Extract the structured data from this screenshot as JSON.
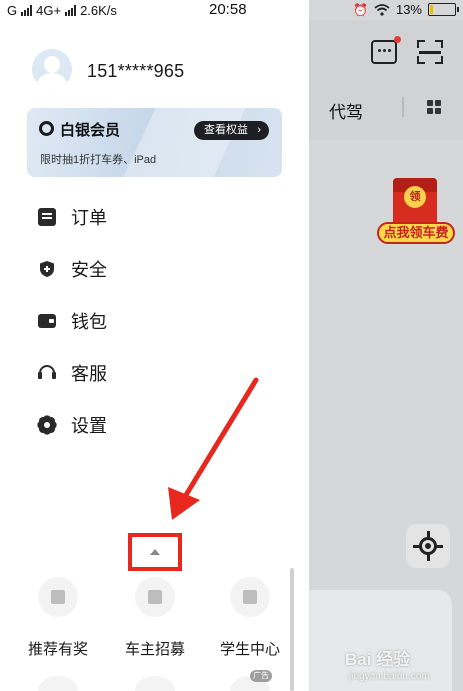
{
  "status_bar": {
    "carrier_left": "G",
    "network": "4G+",
    "speed": "2.6K/s",
    "time": "20:58",
    "battery": "13%",
    "battery_level": 0.13
  },
  "drawer": {
    "phone": "151*****965",
    "member_card": {
      "title": "白银会员",
      "button": "查看权益",
      "subtitle": "限时抽1折打车券、iPad"
    },
    "menu": [
      {
        "label": "订单",
        "icon": "order-icon"
      },
      {
        "label": "安全",
        "icon": "shield-icon"
      },
      {
        "label": "钱包",
        "icon": "wallet-icon"
      },
      {
        "label": "客服",
        "icon": "headset-icon"
      },
      {
        "label": "设置",
        "icon": "gear-icon"
      }
    ],
    "quick": [
      {
        "label": "推荐有奖",
        "icon": "gift-icon"
      },
      {
        "label": "车主招募",
        "icon": "driver-icon"
      },
      {
        "label": "学生中心",
        "icon": "graduation-cap-icon"
      }
    ],
    "ad_tag": "广告"
  },
  "background": {
    "tab": "代驾",
    "redpacket_coin": "领",
    "redpacket_label": "点我领车费"
  },
  "watermark": {
    "text": "Bai 经验",
    "url": "jingyan.baidu.com"
  },
  "colors": {
    "highlight": "#e8281e",
    "arrow": "#e8281e"
  }
}
